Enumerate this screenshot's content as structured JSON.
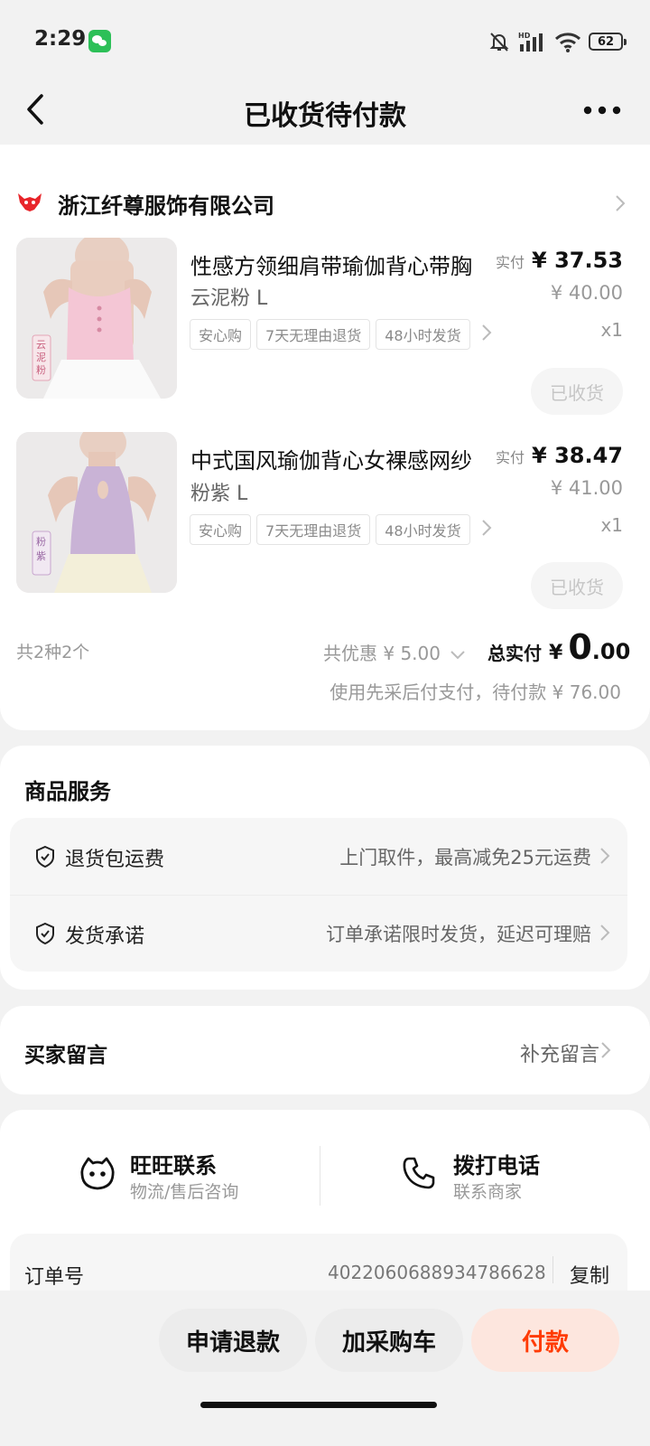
{
  "status": {
    "time": "2:29",
    "battery": "62"
  },
  "nav": {
    "title": "已收货待付款"
  },
  "shop": {
    "name": "浙江纤尊服饰有限公司"
  },
  "products": [
    {
      "title": "性感方领细肩带瑜伽背心带胸",
      "variant": "云泥粉 L",
      "pay_label": "实付",
      "price": "¥ 37.53",
      "original_price": "¥ 40.00",
      "qty": "x1",
      "tags": [
        "安心购",
        "7天无理由退货",
        "48小时发货"
      ],
      "img_caption": "云泥粉",
      "status": "已收货"
    },
    {
      "title": "中式国风瑜伽背心女裸感网纱",
      "variant": "粉紫 L",
      "pay_label": "实付",
      "price": "¥ 38.47",
      "original_price": "¥ 41.00",
      "qty": "x1",
      "tags": [
        "安心购",
        "7天无理由退货",
        "48小时发货"
      ],
      "img_caption": "粉紫",
      "status": "已收货"
    }
  ],
  "summary": {
    "count": "共2种2个",
    "discount": "共优惠 ¥ 5.00",
    "total_label": "总实付",
    "total_currency": "¥",
    "total_int": "0",
    "total_dec": ".00",
    "note": "使用先采后付支付，待付款 ¥ 76.00"
  },
  "services": {
    "title": "商品服务",
    "items": [
      {
        "name": "退货包运费",
        "desc": "上门取件，最高减免25元运费"
      },
      {
        "name": "发货承诺",
        "desc": "订单承诺限时发货，延迟可理赔"
      }
    ]
  },
  "message": {
    "label": "买家留言",
    "action": "补充留言"
  },
  "contact": {
    "wangwang": {
      "title": "旺旺联系",
      "sub": "物流/售后咨询"
    },
    "phone": {
      "title": "拨打电话",
      "sub": "联系商家"
    }
  },
  "order": {
    "label": "订单号",
    "number": "4022060688934786628",
    "copy": "复制"
  },
  "actions": {
    "refund": "申请退款",
    "cart": "加采购车",
    "pay": "付款"
  },
  "colors": {
    "accent": "#ff3a00",
    "pay_bg": "#fde6de",
    "brand_red": "#e8262b"
  }
}
